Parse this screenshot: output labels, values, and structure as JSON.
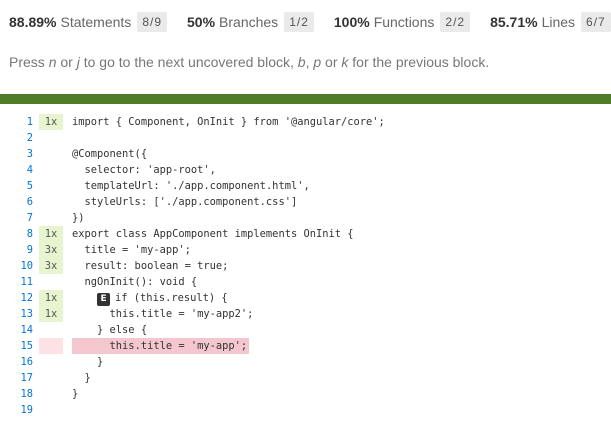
{
  "summary": [
    {
      "pct": "88.89%",
      "label": "Statements",
      "fraction": "8/9"
    },
    {
      "pct": "50%",
      "label": "Branches",
      "fraction": "1/2"
    },
    {
      "pct": "100%",
      "label": "Functions",
      "fraction": "2/2"
    },
    {
      "pct": "85.71%",
      "label": "Lines",
      "fraction": "6/7"
    }
  ],
  "hint": {
    "press": "Press ",
    "k1": "n",
    "or1": " or ",
    "k2": "j",
    "mid": " to go to the next uncovered block, ",
    "k3": "b",
    "comma": ", ",
    "k4": "p",
    "or2": " or ",
    "k5": "k",
    "end": " for the previous block."
  },
  "branch_marker": "E",
  "colors": {
    "status_bar": "#4d7e27",
    "covered_hits_bg": "#e6f5d0",
    "uncovered_hits_bg": "#fce1e5",
    "uncovered_line_bg": "#f4c7ce",
    "line_number": "#0074D9"
  },
  "code": [
    {
      "ln": "1",
      "hits": "1x",
      "cov": "yes",
      "text": "import { Component, OnInit } from '@angular/core';"
    },
    {
      "ln": "2",
      "hits": "",
      "cov": "",
      "text": ""
    },
    {
      "ln": "3",
      "hits": "",
      "cov": "",
      "text": "@Component({"
    },
    {
      "ln": "4",
      "hits": "",
      "cov": "",
      "text": "  selector: 'app-root',"
    },
    {
      "ln": "5",
      "hits": "",
      "cov": "",
      "text": "  templateUrl: './app.component.html',"
    },
    {
      "ln": "6",
      "hits": "",
      "cov": "",
      "text": "  styleUrls: ['./app.component.css']"
    },
    {
      "ln": "7",
      "hits": "",
      "cov": "",
      "text": "})"
    },
    {
      "ln": "8",
      "hits": "1x",
      "cov": "yes",
      "text": "export class AppComponent implements OnInit {"
    },
    {
      "ln": "9",
      "hits": "3x",
      "cov": "yes",
      "text": "  title = 'my-app';"
    },
    {
      "ln": "10",
      "hits": "3x",
      "cov": "yes",
      "text": "  result: boolean = true;"
    },
    {
      "ln": "11",
      "hits": "",
      "cov": "",
      "text": "  ngOnInit(): void {"
    },
    {
      "ln": "12",
      "hits": "1x",
      "cov": "yes",
      "text": "if (this.result) {",
      "branch": true,
      "indent": "    "
    },
    {
      "ln": "13",
      "hits": "1x",
      "cov": "yes",
      "text": "      this.title = 'my-app2';"
    },
    {
      "ln": "14",
      "hits": "",
      "cov": "",
      "text": "    } else {"
    },
    {
      "ln": "15",
      "hits": "",
      "cov": "no",
      "text": "      this.title = 'my-app';",
      "uncovered": true
    },
    {
      "ln": "16",
      "hits": "",
      "cov": "",
      "text": "    }"
    },
    {
      "ln": "17",
      "hits": "",
      "cov": "",
      "text": "  }"
    },
    {
      "ln": "18",
      "hits": "",
      "cov": "",
      "text": "}"
    },
    {
      "ln": "19",
      "hits": "",
      "cov": "",
      "text": ""
    }
  ]
}
